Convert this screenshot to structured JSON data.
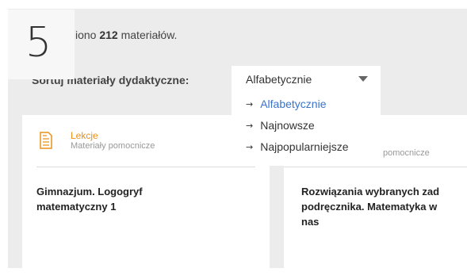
{
  "step": {
    "number": "5"
  },
  "results": {
    "prefix": "iono",
    "count": "212",
    "suffix": "materiałów."
  },
  "sort": {
    "label": "Sortuj materiały dydaktyczne:",
    "selected": "Alfabetycznie",
    "options": [
      "Alfabetycznie",
      "Najnowsze",
      "Najpopularniejsze"
    ]
  },
  "cards": [
    {
      "type": "Lekcje",
      "subtitle": "Materiały pomocnicze",
      "title_lines": [
        "Gimnazjum. Logogryf",
        "matematyczny 1"
      ]
    },
    {
      "subtitle": "pomocnicze",
      "title_lines": [
        "Rozwiązania wybranych zad",
        "podręcznika. Matematyka w",
        "nas"
      ]
    }
  ],
  "colors": {
    "accent": "#e8901a",
    "selected_option": "#3b73c8",
    "panel_bg": "#ececec"
  },
  "icons": {
    "lesson": "document-icon",
    "dropdown": "caret-down-icon",
    "option_marker": "arrow-right-icon"
  }
}
